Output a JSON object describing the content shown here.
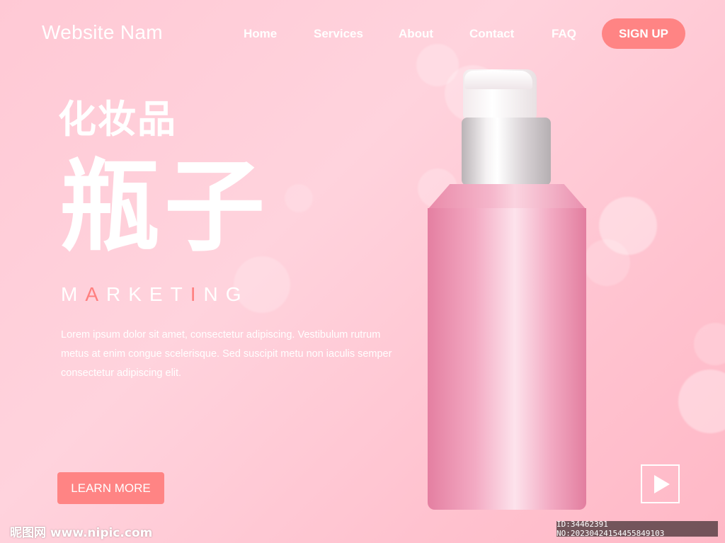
{
  "header": {
    "logo": "Website Nam",
    "nav": [
      "Home",
      "Services",
      "About",
      "Contact",
      "FAQ"
    ],
    "signup_label": "SIGN UP"
  },
  "hero": {
    "subtitle": "化妆品",
    "title": "瓶子",
    "marketing": {
      "part1": "M",
      "accent1": "A",
      "part2": "RKET",
      "accent2": "I",
      "part3": "NG"
    },
    "body": "Lorem ipsum dolor sit amet, consectetur adipiscing. Vestibulum rutrum metus at enim congue scelerisque. Sed suscipit metu non iaculis semper consectetur adipiscing elit.",
    "cta_label": "LEARN MORE"
  },
  "media": {
    "play_icon": "play-icon"
  },
  "watermark": {
    "left": "昵图网 www.nipic.com",
    "right": "ID:34462391 NO:20230424154455849103"
  },
  "colors": {
    "accent": "#ff8484",
    "background": "#ffc9d5",
    "text": "#ffffff"
  }
}
